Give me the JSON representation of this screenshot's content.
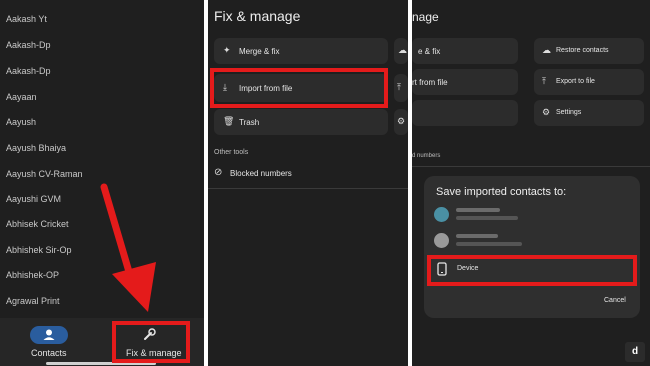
{
  "contacts_panel": {
    "contacts": [
      "Aakash Yt",
      "Aakash-Dp",
      "Aakash-Dp",
      "Aayaan",
      "Aayush",
      "Aayush Bhaiya",
      "Aayush CV-Raman",
      "Aayushi GVM",
      "Abhisek Cricket",
      "Abhishek Sir-Op",
      "Abhishek-OP",
      "Agrawal Print"
    ],
    "nav": {
      "contacts_label": "Contacts",
      "fix_manage_label": "Fix & manage"
    }
  },
  "fix_panel": {
    "title": "Fix & manage",
    "merge_label": "Merge & fix",
    "import_label": "Import from file",
    "trash_label": "Trash",
    "other_tools": "Other tools",
    "blocked_label": "Blocked numbers"
  },
  "dialog_panel": {
    "title_partial": "nage",
    "merge_partial": "e & fix",
    "import_partial": "rt from file",
    "blocked_partial": "d numbers",
    "restore_label": "Restore contacts",
    "export_label": "Export to file",
    "settings_label": "Settings",
    "dialog": {
      "title": "Save imported contacts to:",
      "device_label": "Device",
      "cancel_label": "Cancel"
    }
  },
  "watermark": "d"
}
